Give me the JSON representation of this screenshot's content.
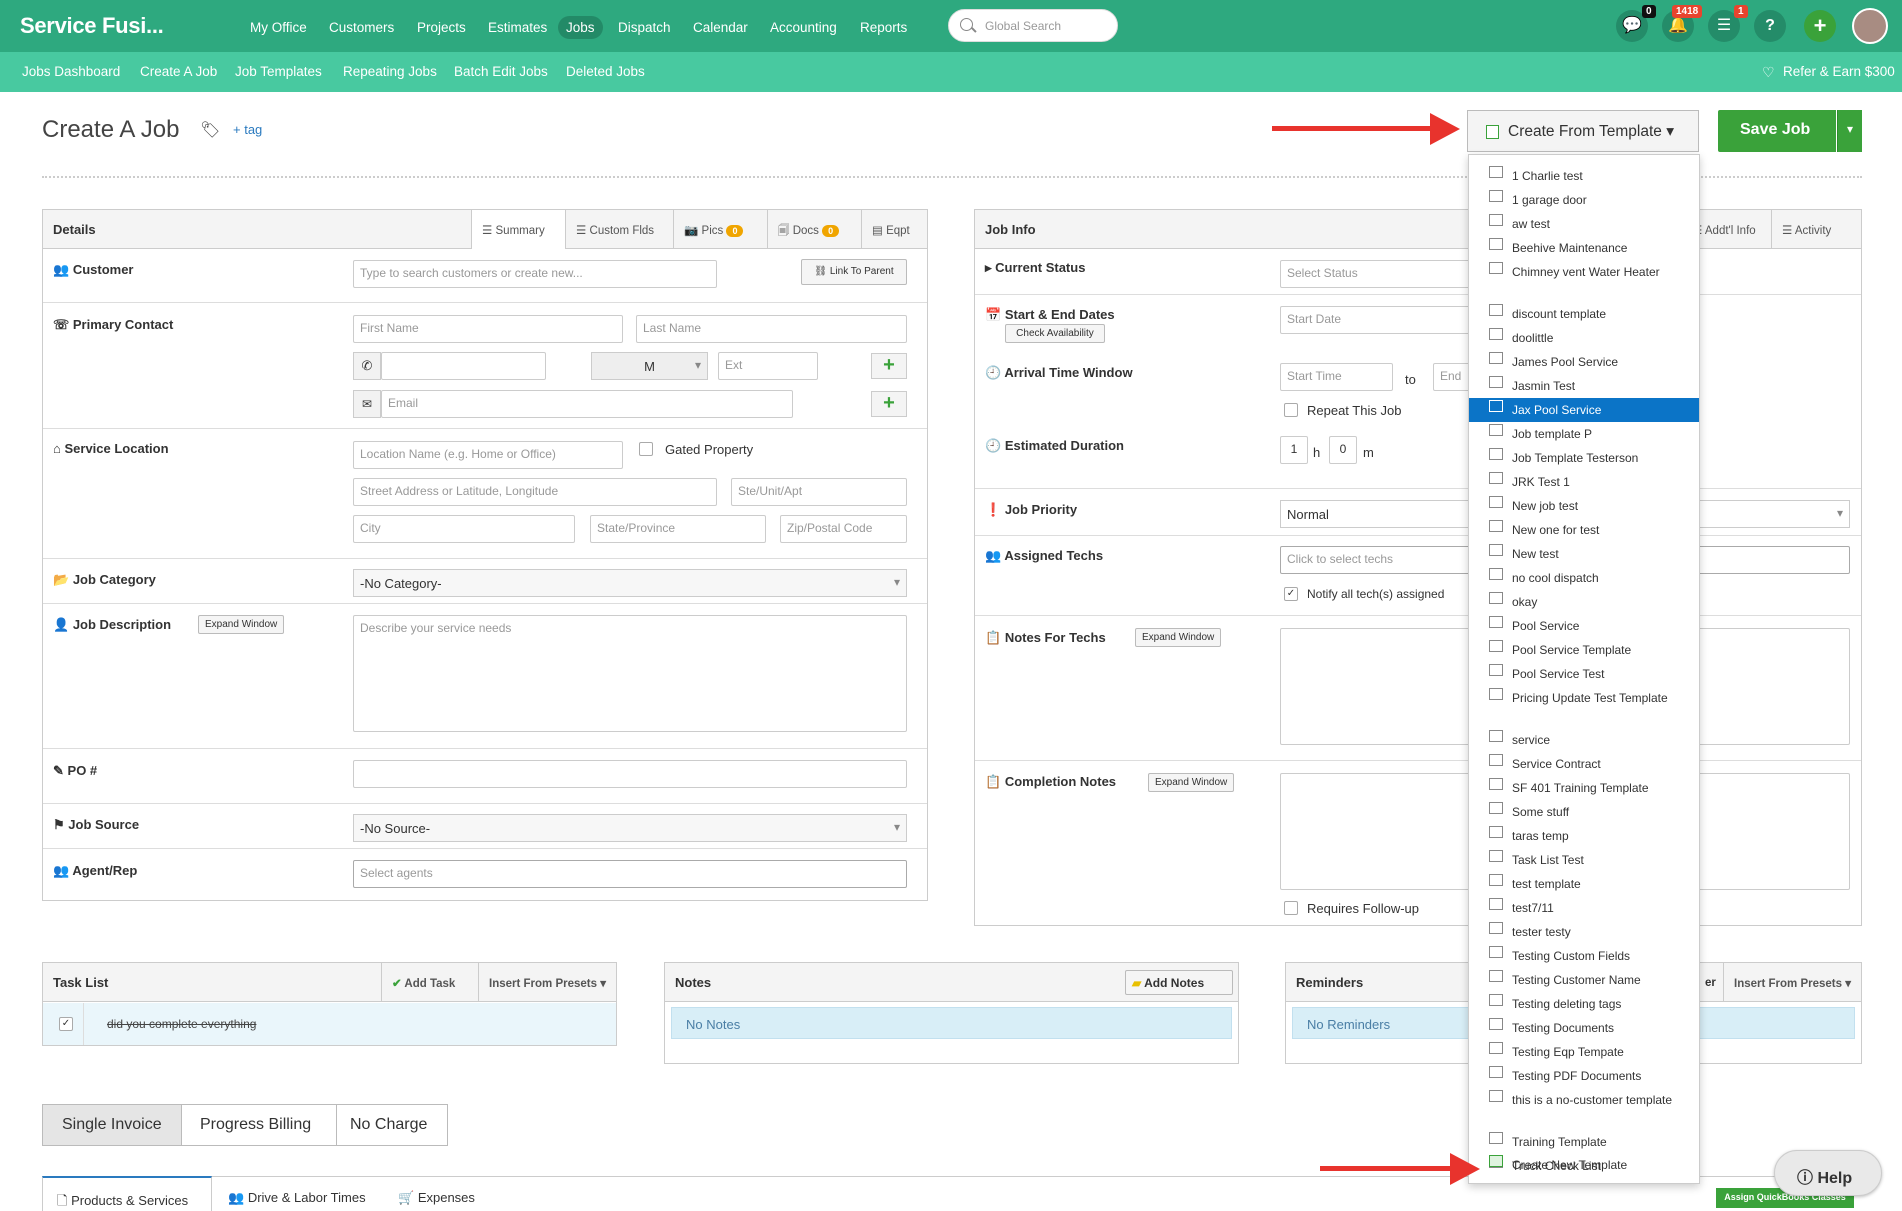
{
  "header": {
    "logo": "Service Fusi...",
    "nav": [
      "My Office",
      "Customers",
      "Projects",
      "Estimates",
      "Jobs",
      "Dispatch",
      "Calendar",
      "Accounting",
      "Reports"
    ],
    "active_nav": "Jobs",
    "search_placeholder": "Global Search",
    "badges": {
      "chat": "0",
      "notifications": "1418",
      "tasks": "1"
    },
    "help_symbol": "?",
    "add_symbol": "+"
  },
  "subnav": {
    "items": [
      "Jobs Dashboard",
      "Create A Job",
      "Job Templates",
      "Repeating Jobs",
      "Batch Edit Jobs",
      "Deleted Jobs"
    ],
    "refer": "Refer & Earn $300"
  },
  "page": {
    "title": "Create A Job",
    "tag_link": "+ tag",
    "create_from_template": "Create From Template",
    "save_job": "Save Job"
  },
  "details": {
    "title": "Details",
    "tabs": [
      "Summary",
      "Custom Flds",
      "Pics",
      "Docs",
      "Eqpt"
    ],
    "pics_count": "0",
    "docs_count": "0",
    "customer_label": "Customer",
    "customer_placeholder": "Type to search customers or create new...",
    "link_to_parent": "Link To Parent",
    "primary_contact_label": "Primary Contact",
    "first_name": "First Name",
    "last_name": "Last Name",
    "phone_type": "M",
    "ext": "Ext",
    "email": "Email",
    "service_location_label": "Service Location",
    "location_name": "Location Name (e.g. Home or Office)",
    "gated_property": "Gated Property",
    "street": "Street Address or Latitude, Longitude",
    "ste": "Ste/Unit/Apt",
    "city": "City",
    "state": "State/Province",
    "zip": "Zip/Postal Code",
    "job_category_label": "Job Category",
    "job_category_value": "-No Category-",
    "job_description_label": "Job Description",
    "expand_window": "Expand Window",
    "description_placeholder": "Describe your service needs",
    "po_label": "PO #",
    "job_source_label": "Job Source",
    "job_source_value": "-No Source-",
    "agent_label": "Agent/Rep",
    "agent_placeholder": "Select agents"
  },
  "job_info": {
    "title": "Job Info",
    "tabs": [
      "Addt'l Info",
      "Activity"
    ],
    "current_status_label": "Current Status",
    "status_placeholder": "Select Status",
    "dates_label": "Start & End Dates",
    "check_availability": "Check Availability",
    "start_date": "Start Date",
    "arrival_label": "Arrival Time Window",
    "start_time": "Start Time",
    "to": "to",
    "end_time": "End",
    "repeat_job": "Repeat This Job",
    "duration_label": "Estimated Duration",
    "hours": "1",
    "h": "h",
    "minutes": "0",
    "m": "m",
    "priority_label": "Job Priority",
    "priority_value": "Normal",
    "techs_label": "Assigned Techs",
    "techs_placeholder": "Click to select techs",
    "notify_techs": "Notify all tech(s) assigned",
    "notes_techs_label": "Notes For Techs",
    "completion_label": "Completion Notes",
    "requires_followup": "Requires Follow-up"
  },
  "template_dropdown": {
    "items": [
      "1 Charlie test",
      "1 garage door",
      "aw test",
      "Beehive Maintenance",
      "Chimney vent Water Heater",
      "discount template",
      "doolittle",
      "James Pool Service",
      "Jasmin Test",
      "Jax Pool Service",
      "Job template P",
      "Job Template Testerson",
      "JRK Test 1",
      "New job test",
      "New one for test",
      "New test",
      "no cool dispatch",
      "okay",
      "Pool Service",
      "Pool Service Template",
      "Pool Service Test",
      "Pricing Update Test Template",
      "service",
      "Service Contract",
      "SF 401 Training Template",
      "Some stuff",
      "taras temp",
      "Task List Test",
      "test template",
      "test7/11",
      "tester testy",
      "Testing Custom Fields",
      "Testing Customer Name",
      "Testing deleting tags",
      "Testing Documents",
      "Testing Eqp Tempate",
      "Testing PDF Documents",
      "this is a no-customer template",
      "Training Template",
      "Truck Check List"
    ],
    "highlighted": "Jax Pool Service",
    "create_new": "Create New Template"
  },
  "task_list": {
    "title": "Task List",
    "add_task": "Add Task",
    "insert_presets": "Insert From Presets",
    "tasks": [
      "did you complete everything"
    ]
  },
  "notes": {
    "title": "Notes",
    "add_notes": "Add Notes",
    "empty": "No Notes"
  },
  "reminders": {
    "title": "Reminders",
    "insert_presets": "Insert From Presets",
    "empty": "No Reminders",
    "partial_label": "er"
  },
  "billing": [
    "Single Invoice",
    "Progress Billing",
    "No Charge"
  ],
  "bottom_tabs": [
    "Products & Services",
    "Drive & Labor Times",
    "Expenses"
  ],
  "assign_quickbooks": "Assign QuickBooks Classes",
  "help": "Help",
  "colors": {
    "brand": "#2ea97f",
    "subnav": "#48c9a0",
    "save": "#3aa23a",
    "highlight": "#0b74c7",
    "arrow": "#e8332d"
  }
}
